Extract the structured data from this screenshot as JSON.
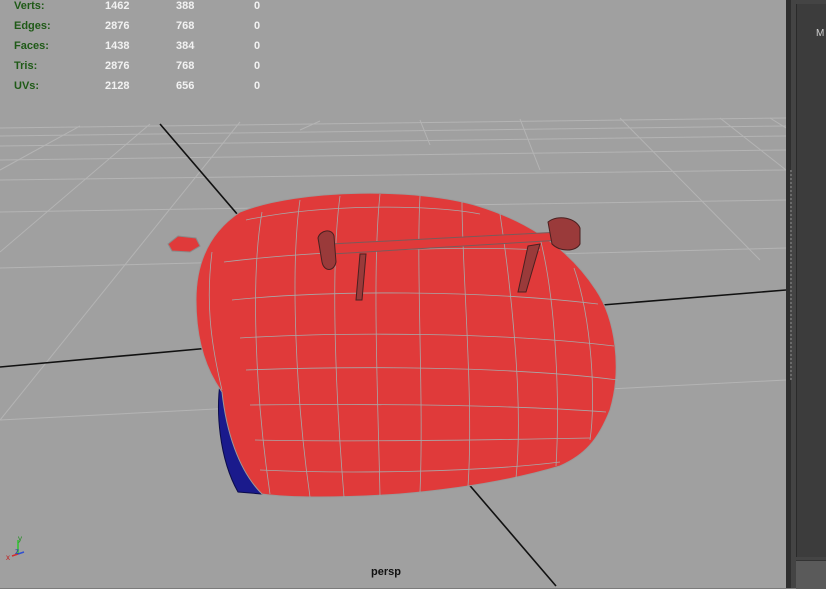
{
  "hud": {
    "rows": [
      {
        "label": "Verts:",
        "v1": "1462",
        "v2": "388",
        "v3": "0"
      },
      {
        "label": "Edges:",
        "v1": "2876",
        "v2": "768",
        "v3": "0"
      },
      {
        "label": "Faces:",
        "v1": "1438",
        "v2": "384",
        "v3": "0"
      },
      {
        "label": "Tris:",
        "v1": "2876",
        "v2": "768",
        "v3": "0"
      },
      {
        "label": "UVs:",
        "v1": "2128",
        "v2": "656",
        "v3": "0"
      }
    ]
  },
  "viewport": {
    "camera": "persp",
    "background": "#a0a0a0",
    "model_color": "#e03a3a",
    "wheel_color": "#1a1a8c"
  },
  "axis": {
    "x": "x",
    "y": "y",
    "z": "z"
  },
  "side_panel": {
    "tab_label": "M"
  }
}
